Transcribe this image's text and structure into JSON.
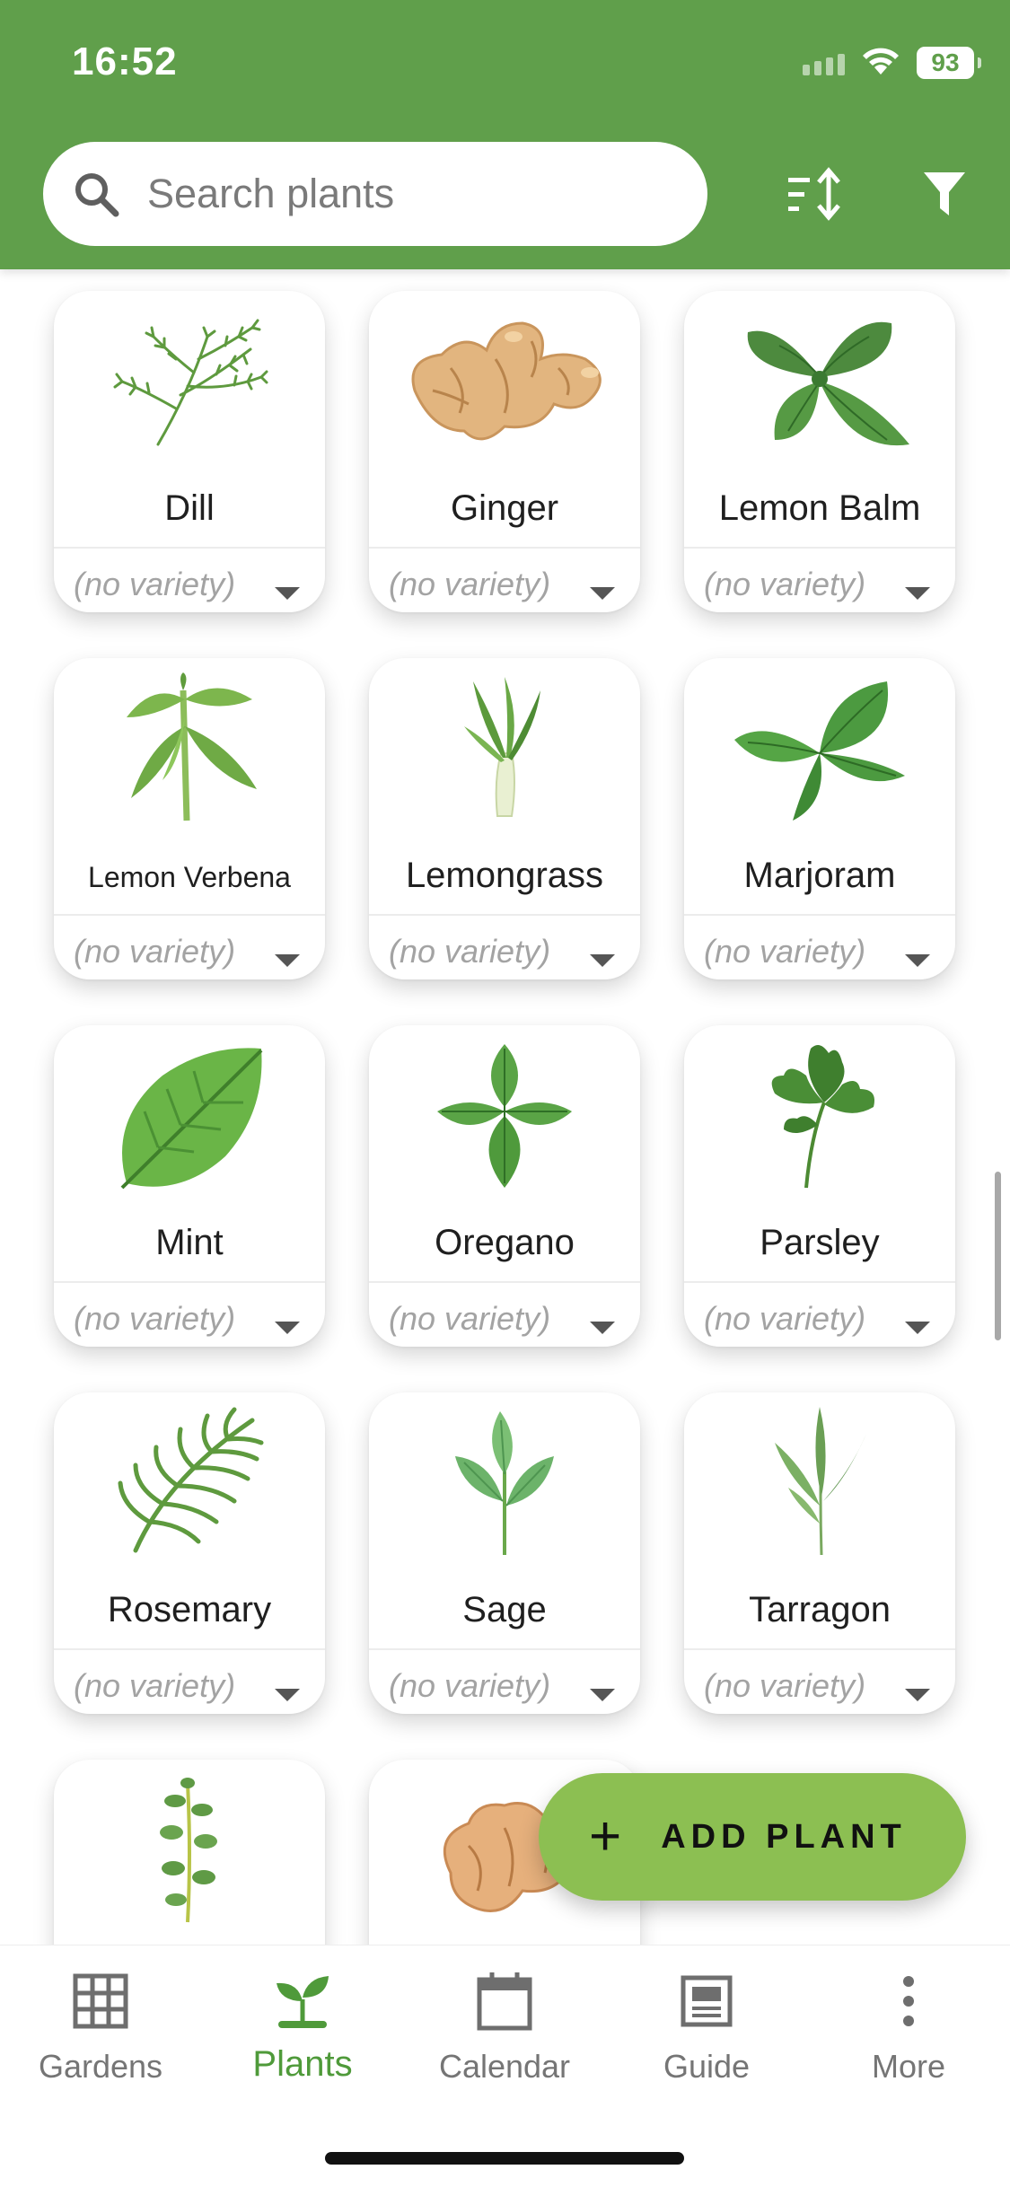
{
  "status_bar": {
    "time": "16:52",
    "battery": "93"
  },
  "search": {
    "placeholder": "Search plants"
  },
  "plants": [
    {
      "name": "Dill",
      "variety": "(no variety)"
    },
    {
      "name": "Ginger",
      "variety": "(no variety)"
    },
    {
      "name": "Lemon Balm",
      "variety": "(no variety)"
    },
    {
      "name": "Lemon Verbena",
      "variety": "(no variety)"
    },
    {
      "name": "Lemongrass",
      "variety": "(no variety)"
    },
    {
      "name": "Marjoram",
      "variety": "(no variety)"
    },
    {
      "name": "Mint",
      "variety": "(no variety)"
    },
    {
      "name": "Oregano",
      "variety": "(no variety)"
    },
    {
      "name": "Parsley",
      "variety": "(no variety)"
    },
    {
      "name": "Rosemary",
      "variety": "(no variety)"
    },
    {
      "name": "Sage",
      "variety": "(no variety)"
    },
    {
      "name": "Tarragon",
      "variety": "(no variety)"
    }
  ],
  "fab": {
    "label": "ADD PLANT"
  },
  "nav": {
    "gardens": "Gardens",
    "plants": "Plants",
    "calendar": "Calendar",
    "guide": "Guide",
    "more": "More"
  },
  "colors": {
    "header": "#609f4b",
    "accent": "#4f9a3a",
    "fab": "#8cbf52"
  }
}
